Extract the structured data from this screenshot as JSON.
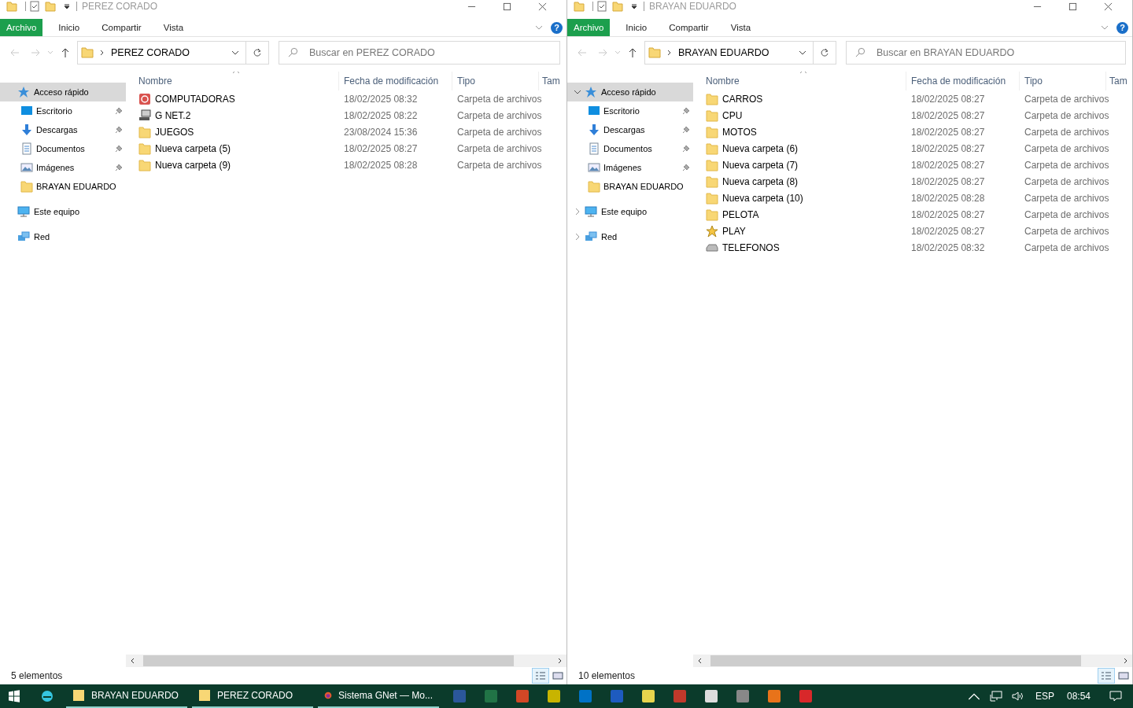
{
  "windows": [
    {
      "title": "PEREZ CORADO",
      "ribbon_tabs": [
        {
          "label": "Archivo",
          "kind": "file"
        },
        {
          "label": "Inicio",
          "kind": "tab"
        },
        {
          "label": "Compartir",
          "kind": "tab"
        },
        {
          "label": "Vista",
          "kind": "tab"
        }
      ],
      "help": "?",
      "address": "PEREZ CORADO",
      "search_placeholder": "Buscar en PEREZ CORADO",
      "nav": [
        {
          "label": "Acceso rápido",
          "kind": "quick-access",
          "selected": true,
          "children": [
            {
              "label": "Escritorio",
              "kind": "desktop",
              "pinned": true
            },
            {
              "label": "Descargas",
              "kind": "downloads",
              "pinned": true
            },
            {
              "label": "Documentos",
              "kind": "documents",
              "pinned": true
            },
            {
              "label": "Imágenes",
              "kind": "pictures",
              "pinned": true
            },
            {
              "label": "BRAYAN EDUARDO",
              "kind": "folder",
              "pinned": false
            }
          ]
        },
        {
          "label": "Este equipo",
          "kind": "computer",
          "selected": false
        },
        {
          "label": "Red",
          "kind": "network",
          "selected": false
        }
      ],
      "columns": [
        {
          "label": "Nombre",
          "sorted": true
        },
        {
          "label": "Fecha de modificación",
          "sorted": false
        },
        {
          "label": "Tipo",
          "sorted": false
        },
        {
          "label": "Tam",
          "sorted": false
        }
      ],
      "rows": [
        {
          "name": "COMPUTADORAS",
          "kind": "app",
          "date": "18/02/2025 08:32",
          "type": "Carpeta de archivos"
        },
        {
          "name": "G NET.2",
          "kind": "computer",
          "date": "18/02/2025 08:22",
          "type": "Carpeta de archivos"
        },
        {
          "name": "JUEGOS",
          "kind": "folder",
          "date": "23/08/2024 15:36",
          "type": "Carpeta de archivos"
        },
        {
          "name": "Nueva carpeta (5)",
          "kind": "folder",
          "date": "18/02/2025 08:27",
          "type": "Carpeta de archivos"
        },
        {
          "name": "Nueva carpeta (9)",
          "kind": "folder",
          "date": "18/02/2025 08:28",
          "type": "Carpeta de archivos"
        }
      ],
      "status": "5 elementos"
    },
    {
      "title": "BRAYAN EDUARDO",
      "ribbon_tabs": [
        {
          "label": "Archivo",
          "kind": "file"
        },
        {
          "label": "Inicio",
          "kind": "tab"
        },
        {
          "label": "Compartir",
          "kind": "tab"
        },
        {
          "label": "Vista",
          "kind": "tab"
        }
      ],
      "help": "?",
      "address": "BRAYAN EDUARDO",
      "search_placeholder": "Buscar en BRAYAN EDUARDO",
      "nav": [
        {
          "label": "Acceso rápido",
          "kind": "quick-access",
          "selected": true,
          "expanded": true,
          "children": [
            {
              "label": "Escritorio",
              "kind": "desktop",
              "pinned": true
            },
            {
              "label": "Descargas",
              "kind": "downloads",
              "pinned": true
            },
            {
              "label": "Documentos",
              "kind": "documents",
              "pinned": true
            },
            {
              "label": "Imágenes",
              "kind": "pictures",
              "pinned": true
            },
            {
              "label": "BRAYAN EDUARDO",
              "kind": "folder",
              "pinned": false
            }
          ]
        },
        {
          "label": "Este equipo",
          "kind": "computer",
          "selected": false,
          "expanded": false
        },
        {
          "label": "Red",
          "kind": "network",
          "selected": false,
          "expanded": false
        }
      ],
      "columns": [
        {
          "label": "Nombre",
          "sorted": true
        },
        {
          "label": "Fecha de modificación",
          "sorted": false
        },
        {
          "label": "Tipo",
          "sorted": false
        },
        {
          "label": "Tam",
          "sorted": false
        }
      ],
      "rows": [
        {
          "name": "CARROS",
          "kind": "folder",
          "date": "18/02/2025 08:27",
          "type": "Carpeta de archivos"
        },
        {
          "name": "CPU",
          "kind": "folder",
          "date": "18/02/2025 08:27",
          "type": "Carpeta de archivos"
        },
        {
          "name": "MOTOS",
          "kind": "folder",
          "date": "18/02/2025 08:27",
          "type": "Carpeta de archivos"
        },
        {
          "name": "Nueva carpeta (6)",
          "kind": "folder",
          "date": "18/02/2025 08:27",
          "type": "Carpeta de archivos"
        },
        {
          "name": "Nueva carpeta (7)",
          "kind": "folder",
          "date": "18/02/2025 08:27",
          "type": "Carpeta de archivos"
        },
        {
          "name": "Nueva carpeta (8)",
          "kind": "folder",
          "date": "18/02/2025 08:27",
          "type": "Carpeta de archivos"
        },
        {
          "name": "Nueva carpeta (10)",
          "kind": "folder",
          "date": "18/02/2025 08:28",
          "type": "Carpeta de archivos"
        },
        {
          "name": "PELOTA",
          "kind": "folder",
          "date": "18/02/2025 08:27",
          "type": "Carpeta de archivos"
        },
        {
          "name": "PLAY",
          "kind": "star",
          "date": "18/02/2025 08:27",
          "type": "Carpeta de archivos"
        },
        {
          "name": "TELEFONOS",
          "kind": "drive",
          "date": "18/02/2025 08:32",
          "type": "Carpeta de archivos"
        }
      ],
      "status": "10 elementos"
    }
  ],
  "taskbar": {
    "windows": [
      {
        "label": "BRAYAN EDUARDO",
        "kind": "folder"
      },
      {
        "label": "PEREZ CORADO",
        "kind": "folder"
      },
      {
        "label": "Sistema GNet — Mo...",
        "kind": "browser"
      }
    ],
    "pinned": [
      {
        "kind": "word"
      },
      {
        "kind": "excel"
      },
      {
        "kind": "powerpoint"
      },
      {
        "kind": "tool"
      },
      {
        "kind": "outlook"
      },
      {
        "kind": "chart"
      },
      {
        "kind": "notes"
      },
      {
        "kind": "brush"
      },
      {
        "kind": "pattern"
      },
      {
        "kind": "database"
      },
      {
        "kind": "orange-app"
      },
      {
        "kind": "red-app"
      }
    ],
    "language": "ESP",
    "time": "08:54"
  }
}
